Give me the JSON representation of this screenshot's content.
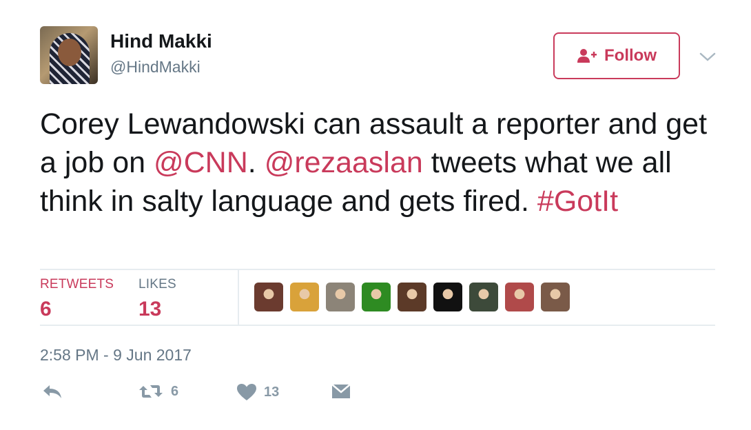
{
  "user": {
    "display_name": "Hind Makki",
    "screen_name": "@HindMakki"
  },
  "follow_button": {
    "label": "Follow",
    "icon": "add-person-icon"
  },
  "tweet": {
    "text_segments": [
      {
        "text": "Corey Lewandowski can assault a reporter and get a job on ",
        "link": false
      },
      {
        "text": "@CNN",
        "link": true
      },
      {
        "text": ". ",
        "link": false
      },
      {
        "text": "@rezaaslan",
        "link": true
      },
      {
        "text": " tweets what we all think in salty language and gets fired. ",
        "link": false
      },
      {
        "text": "#GotIt",
        "link": true
      }
    ]
  },
  "stats": {
    "retweets_label": "RETWEETS",
    "retweets_count": "6",
    "likes_label": "LIKES",
    "likes_count": "13"
  },
  "likers": [
    {
      "name": "liker-avatar-1",
      "color": "#6b3b2f"
    },
    {
      "name": "liker-avatar-2",
      "color": "#d9a23a"
    },
    {
      "name": "liker-avatar-3",
      "color": "#8c8478"
    },
    {
      "name": "liker-avatar-4",
      "color": "#2e8b22"
    },
    {
      "name": "liker-avatar-5",
      "color": "#5c3a28"
    },
    {
      "name": "liker-avatar-6",
      "color": "#111111"
    },
    {
      "name": "liker-avatar-7",
      "color": "#3d4a3a"
    },
    {
      "name": "liker-avatar-8",
      "color": "#b04a4a"
    },
    {
      "name": "liker-avatar-9",
      "color": "#7a5a48"
    }
  ],
  "timestamp": "2:58 PM - 9 Jun 2017",
  "actions": {
    "reply_icon": "reply-icon",
    "retweet_icon": "retweet-icon",
    "retweet_count": "6",
    "like_icon": "heart-icon",
    "like_count": "13",
    "dm_icon": "direct-message-icon"
  },
  "colors": {
    "accent": "#c93a5b",
    "muted": "#657786",
    "icon_gray": "#8899a6",
    "divider": "#e6ecf0"
  }
}
